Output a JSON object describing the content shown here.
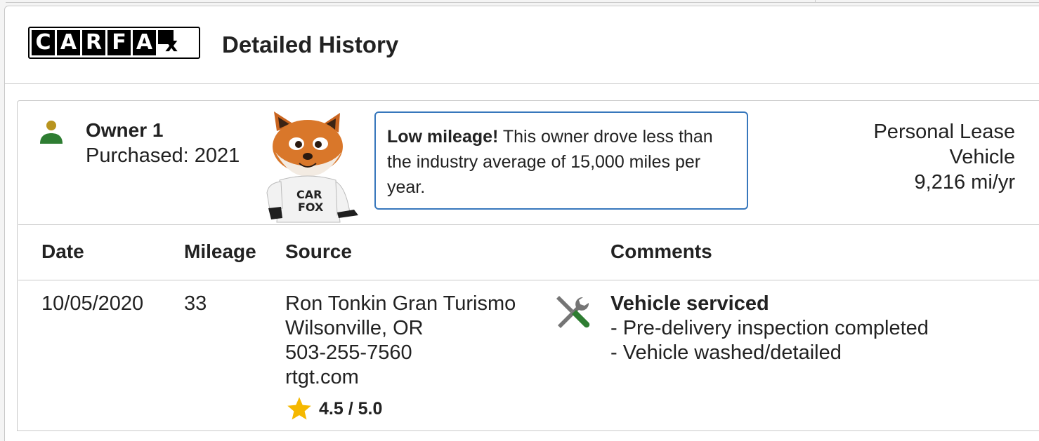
{
  "header": {
    "logo_letters": [
      "C",
      "A",
      "R",
      "F",
      "A"
    ],
    "logo_tail": "x",
    "title": "Detailed History"
  },
  "owner": {
    "name": "Owner 1",
    "purchased": "Purchased: 2021",
    "callout": {
      "bold": "Low mileage!",
      "text": " This owner drove less than the industry average of 15,000 miles per year."
    },
    "type_line1": "Personal Lease",
    "type_line2": "Vehicle",
    "mileage_rate": "9,216 mi/yr",
    "fox_shirt_text": "CAR FOX"
  },
  "table": {
    "headers": {
      "date": "Date",
      "mileage": "Mileage",
      "source": "Source",
      "comments": "Comments"
    },
    "rows": [
      {
        "date": "10/05/2020",
        "mileage": "33",
        "source": {
          "name": "Ron Tonkin Gran Turismo",
          "location": "Wilsonville, OR",
          "phone": "503-255-7560",
          "website": "rtgt.com",
          "rating": "4.5 / 5.0"
        },
        "comments": {
          "title": "Vehicle serviced",
          "items": [
            "- Pre-delivery inspection completed",
            "- Vehicle washed/detailed"
          ]
        },
        "icon": "wrench-screwdriver-icon"
      }
    ]
  },
  "colors": {
    "owner_icon_head": "#b8941f",
    "owner_icon_body": "#2e7d32",
    "callout_border": "#3777bc",
    "star": "#f5b800",
    "service_icon_green": "#2e7d32"
  }
}
